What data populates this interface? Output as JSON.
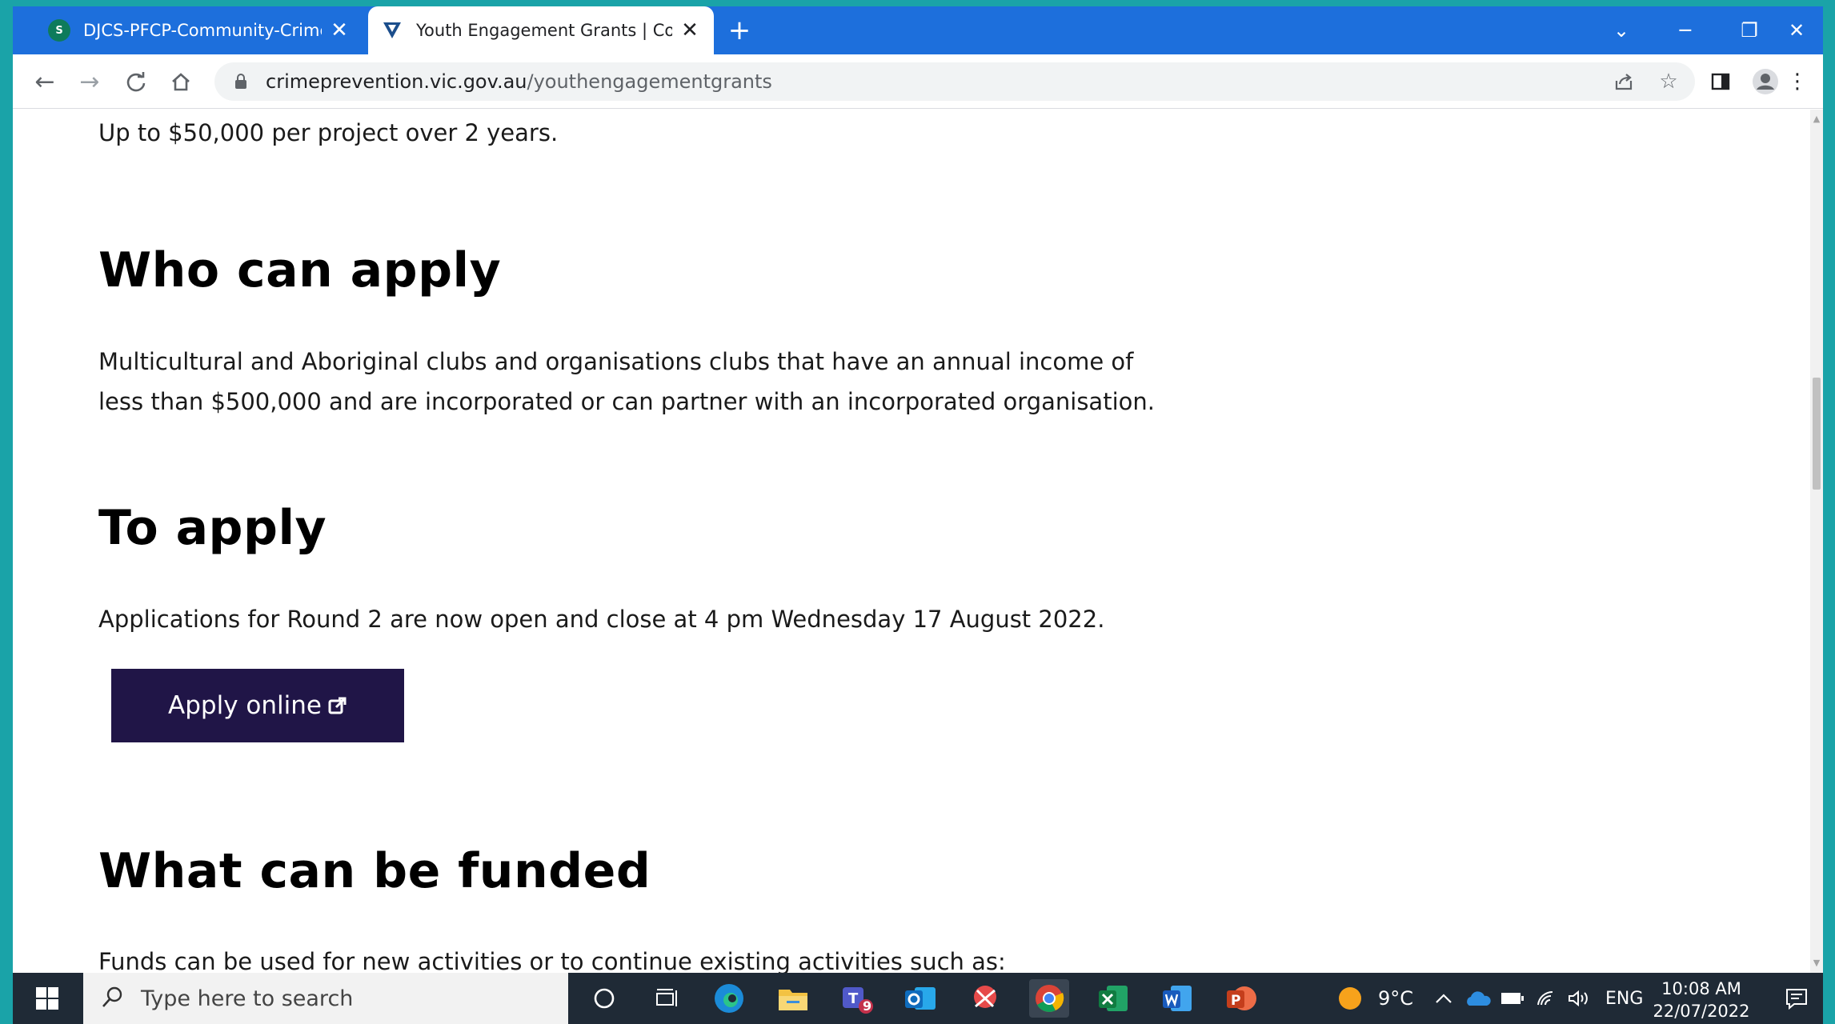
{
  "browser": {
    "tabs": [
      {
        "title": "DJCS-PFCP-Community-Crime-P",
        "favicon": "sharepoint-icon",
        "active": false
      },
      {
        "title": "Youth Engagement Grants | Com",
        "favicon": "vic-gov-icon",
        "active": true
      }
    ],
    "url_domain": "crimeprevention.vic.gov.au",
    "url_path": "/youthengagementgrants",
    "accent": "#1d6fdc"
  },
  "page": {
    "intro": "Up to $50,000 per project over 2 years.",
    "sections": [
      {
        "heading": "Who can apply",
        "lines": [
          "Multicultural and Aboriginal clubs and organisations clubs that have an annual income of",
          "less than $500,000 and are incorporated or can partner with an incorporated organisation."
        ]
      },
      {
        "heading": "To apply",
        "lines": [
          "Applications for Round 2 are now open and close at 4 pm Wednesday 17 August 2022."
        ],
        "button": "Apply online"
      },
      {
        "heading": "What can be funded",
        "lines": [
          "Funds can be used for new activities or to continue existing activities such as:"
        ]
      }
    ],
    "button_color": "#201547"
  },
  "taskbar": {
    "search_placeholder": "Type here to search",
    "teams_badge": "9",
    "weather": "9°C",
    "language": "ENG",
    "time": "10:08 AM",
    "date": "22/07/2022"
  }
}
